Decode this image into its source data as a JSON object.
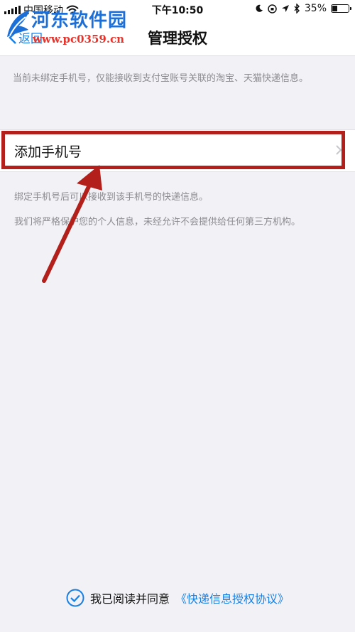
{
  "status_bar": {
    "carrier": "中国移动",
    "time": "下午10:50",
    "battery": "35%",
    "battery_level": 0.35
  },
  "nav": {
    "back_label": "返回",
    "title": "管理授权"
  },
  "watermark": {
    "title": "河东软件园",
    "url": "www.pc0359.cn"
  },
  "info_text": "当前未绑定手机号，仅能接收到支付宝账号关联的淘宝、天猫快递信息。",
  "row": {
    "label": "添加手机号"
  },
  "notes": [
    "绑定手机号后可以接收到该手机号的快递信息。",
    "我们将严格保护您的个人信息，未经允许不会提供给任何第三方机构。"
  ],
  "footer": {
    "agree_text": "我已阅读并同意",
    "link_text": "《快递信息授权协议》"
  },
  "colors": {
    "accent": "#1a7fe0",
    "highlight": "#b3201c",
    "background": "#f2f2f6"
  },
  "icons": [
    "signal-icon",
    "wifi-icon",
    "moon-icon",
    "lock-rotation-icon",
    "location-icon",
    "bluetooth-icon",
    "battery-icon",
    "back-chevron-icon",
    "chevron-right-icon",
    "check-circle-icon",
    "annotation-arrow"
  ]
}
